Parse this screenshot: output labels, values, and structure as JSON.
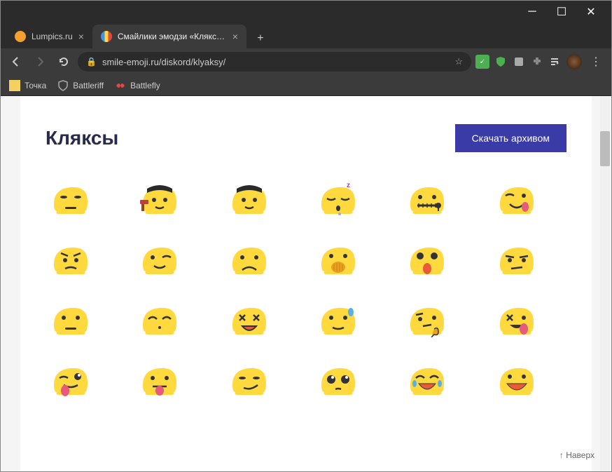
{
  "window": {
    "minimize": "─",
    "maximize": "☐",
    "close": "✕"
  },
  "tabs": [
    {
      "title": "Lumpics.ru",
      "favicon_color": "#f4a030",
      "active": false
    },
    {
      "title": "Смайлики эмодзи «Кляксы» для…",
      "favicon_color": "#ffd93d",
      "active": true
    }
  ],
  "toolbar": {
    "url": "smile-emoji.ru/diskord/klyaksy/"
  },
  "bookmarks": [
    {
      "label": "Точка",
      "icon_color": "#f4d060"
    },
    {
      "label": "Battleriff",
      "icon_color": "#888"
    },
    {
      "label": "Battlefly",
      "icon_color": "#e84545"
    }
  ],
  "page": {
    "title": "Кляксы",
    "download_label": "Скачать архивом",
    "back_to_top": "↑ Наверх"
  },
  "emojis": [
    "blob-annoyed",
    "blob-salute-hammer",
    "blob-salute",
    "blob-sleeping",
    "blob-zipper",
    "blob-yum",
    "blob-confused",
    "blob-wink",
    "blob-frown",
    "blob-hand-mouth",
    "blob-surprised",
    "blob-unamused",
    "blob-neutral",
    "blob-smile-eyes",
    "blob-xd",
    "blob-sweat",
    "blob-thinking",
    "blob-laugh-tongue",
    "blob-tongue-wink",
    "blob-tongue",
    "blob-smirk",
    "blob-pleading",
    "blob-laugh-cry",
    "blob-grin"
  ]
}
